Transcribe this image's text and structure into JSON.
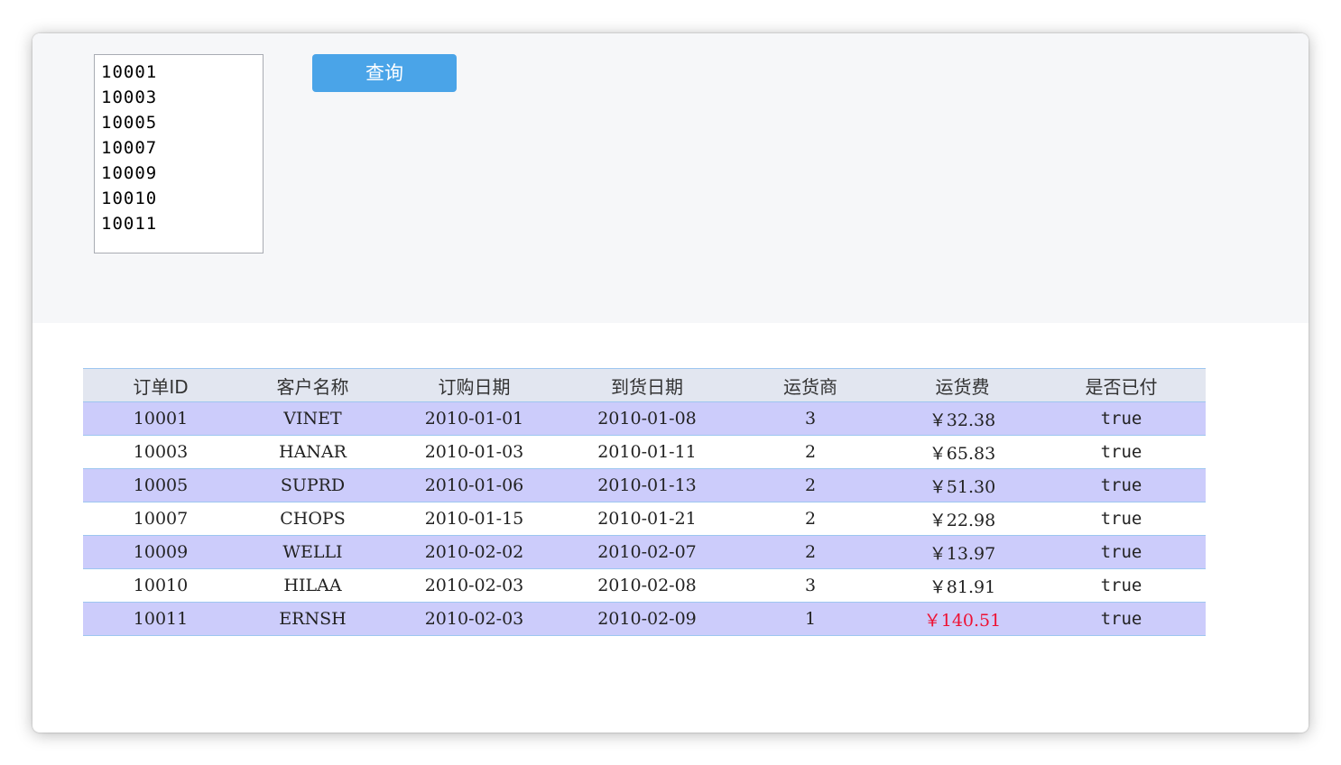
{
  "listbox": {
    "options": [
      "10001",
      "10003",
      "10005",
      "10007",
      "10009",
      "10010",
      "10011"
    ]
  },
  "query_button": {
    "label": "查询"
  },
  "table": {
    "headers": [
      "订单ID",
      "客户名称",
      "订购日期",
      "到货日期",
      "运货商",
      "运货费",
      "是否已付"
    ],
    "rows": [
      [
        "10001",
        "VINET",
        "2010-01-01",
        "2010-01-08",
        "3",
        "￥32.38",
        "true"
      ],
      [
        "10003",
        "HANAR",
        "2010-01-03",
        "2010-01-11",
        "2",
        "￥65.83",
        "true"
      ],
      [
        "10005",
        "SUPRD",
        "2010-01-06",
        "2010-01-13",
        "2",
        "￥51.30",
        "true"
      ],
      [
        "10007",
        "CHOPS",
        "2010-01-15",
        "2010-01-21",
        "2",
        "￥22.98",
        "true"
      ],
      [
        "10009",
        "WELLI",
        "2010-02-02",
        "2010-02-07",
        "2",
        "￥13.97",
        "true"
      ],
      [
        "10010",
        "HILAA",
        "2010-02-03",
        "2010-02-08",
        "3",
        "￥81.91",
        "true"
      ],
      [
        "10011",
        "ERNSH",
        "2010-02-03",
        "2010-02-09",
        "1",
        "￥140.51",
        "true"
      ]
    ],
    "highlight_freight_row": 6
  },
  "colors": {
    "button": "#4aa4e8",
    "row_alt": "#ccccfb",
    "row_border": "#9dc6f0",
    "header_bg": "#e2e6f0",
    "highlight_text": "#ee1133"
  }
}
